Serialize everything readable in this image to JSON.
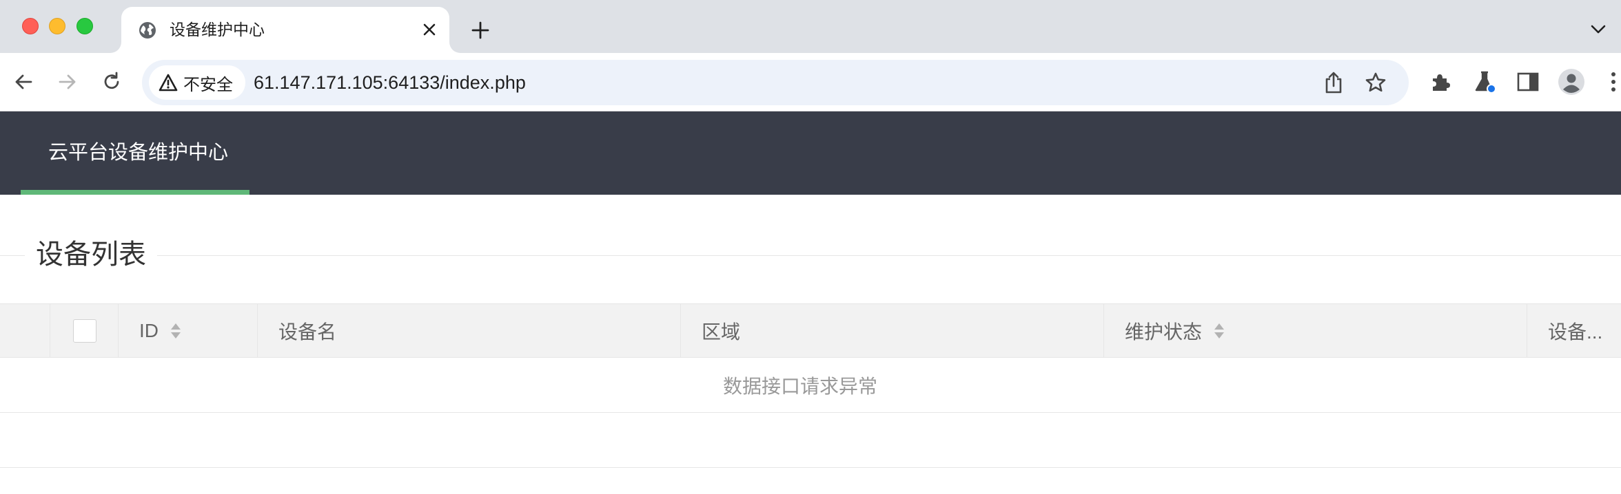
{
  "browser": {
    "tab": {
      "title": "设备维护中心",
      "favicon": "globe-icon",
      "close_icon": "close-icon"
    },
    "new_tab_icon": "plus-icon",
    "tab_list_icon": "chevron-down-icon",
    "nav": {
      "back_icon": "back-arrow-icon",
      "forward_icon": "forward-arrow-icon",
      "reload_icon": "reload-icon"
    },
    "omnibox": {
      "security_label": "不安全",
      "security_icon": "warning-triangle-icon",
      "url": "61.147.171.105:64133/index.php",
      "share_icon": "share-icon",
      "bookmark_icon": "star-icon"
    },
    "toolbar_icons": [
      "puzzle-icon",
      "flask-icon",
      "side-panel-icon",
      "profile-icon",
      "kebab-menu-icon"
    ]
  },
  "app": {
    "brand_label": "云平台设备维护中心",
    "colors": {
      "header_bg": "#393d49",
      "active_underline": "#5fb878",
      "table_header_bg": "#f2f2f2"
    }
  },
  "main": {
    "section_title": "设备列表",
    "table": {
      "columns": [
        {
          "label": "",
          "type": "checkbox"
        },
        {
          "label": "ID",
          "sortable": true
        },
        {
          "label": "设备名",
          "sortable": false
        },
        {
          "label": "区域",
          "sortable": false
        },
        {
          "label": "维护状态",
          "sortable": true
        },
        {
          "label": "设备...",
          "sortable": false
        }
      ],
      "empty_message": "数据接口请求异常"
    }
  }
}
